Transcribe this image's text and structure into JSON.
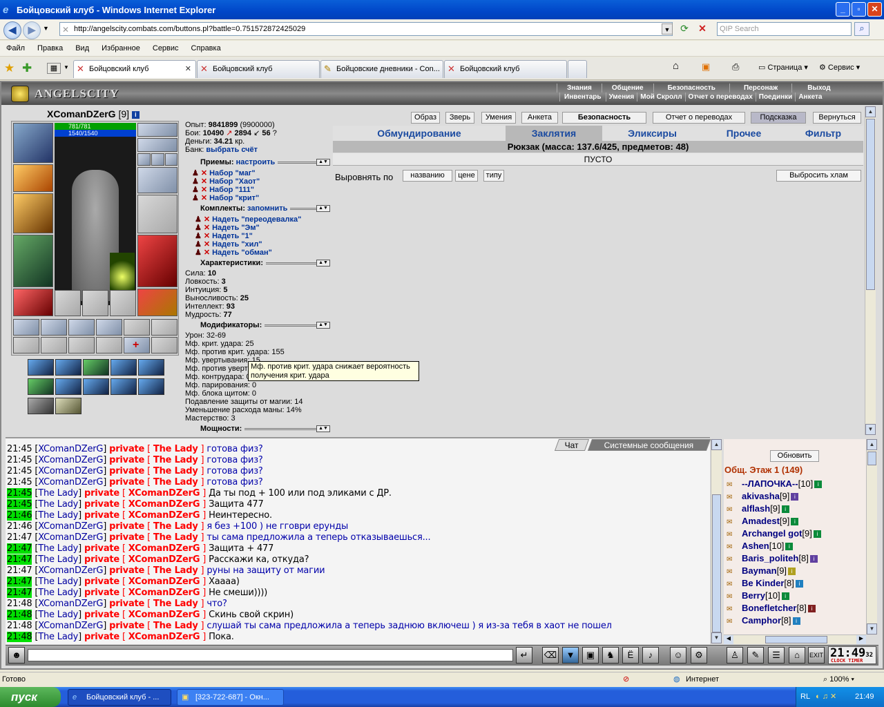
{
  "window": {
    "title": "Бойцовский клуб - Windows Internet Explorer"
  },
  "address": {
    "url": "http://angelscity.combats.com/buttons.pl?battle=0.751572872425029",
    "search_placeholder": "QIP Search"
  },
  "menu": [
    "Файл",
    "Правка",
    "Вид",
    "Избранное",
    "Сервис",
    "Справка"
  ],
  "tabs": [
    {
      "label": "Бойцовский клуб",
      "active": true
    },
    {
      "label": "Бойцовский клуб",
      "active": false
    },
    {
      "label": "Бойцовские дневники - Con...",
      "active": false
    },
    {
      "label": "Бойцовский клуб",
      "active": false
    }
  ],
  "toolbar_right": {
    "page": "Страница",
    "tools": "Сервис"
  },
  "game": {
    "logo": "ANGELSCITY",
    "topnav1": [
      "Знания",
      "Общение",
      "Безопасность",
      "Персонаж",
      "Выход"
    ],
    "topnav2": [
      "Инвентарь",
      "Умения",
      "Мой Скролл",
      "Отчет о переводах",
      "Поединки",
      "Анкета"
    ],
    "char": {
      "name": "XComanDZerG",
      "level": "[9]",
      "hp": "781/781",
      "mana": "1540/1540"
    },
    "exp": {
      "label": "Опыт:",
      "value": "9841899",
      "next": "(9900000)"
    },
    "battles": {
      "label": "Бои:",
      "wins": "10490",
      "losses": "2894",
      "draws": "56"
    },
    "money": {
      "label": "Деньги:",
      "value": "34.21",
      "unit": "кр."
    },
    "bank": {
      "label": "Банк:",
      "link": "выбрать счёт"
    },
    "sections": {
      "tricks": "Приемы:",
      "tricks_link": "настроить",
      "sets": "Комплекты:",
      "sets_link": "запомнить",
      "chars": "Характеристики:",
      "mods": "Модификаторы:",
      "powers": "Мощности:"
    },
    "trick_sets": [
      "Набор \"маг\"",
      "Набор \"Хаот\"",
      "Набор \"111\"",
      "Набор \"крит\""
    ],
    "kits": [
      "Надеть \"переодевалка\"",
      "Надеть \"Эм\"",
      "Надеть \"1\"",
      "Надеть \"хил\"",
      "Надеть \"обман\""
    ],
    "stats": [
      {
        "label": "Сила:",
        "value": "10"
      },
      {
        "label": "Ловкость:",
        "value": "3"
      },
      {
        "label": "Интуиция:",
        "value": "5"
      },
      {
        "label": "Выносливость:",
        "value": "25"
      },
      {
        "label": "Интеллект:",
        "value": "93"
      },
      {
        "label": "Мудрость:",
        "value": "77"
      }
    ],
    "mods": [
      "Урон: 32-69",
      "Мф. крит. удара: 25",
      "Мф. против крит. удара: 155",
      "Мф. увертывания: 15",
      "Мф. против увертывания: 0",
      "Мф. контрудара: 0",
      "Мф. парирования: 0",
      "Мф. блока щитом: 0",
      "Подавление защиты от магии: 14",
      "Уменьшение расхода маны: 14%",
      "Мастерство: 3"
    ],
    "tooltip": "Мф. против крит. удара снижает вероятность получения крит. удара",
    "buttons": [
      "Образ",
      "Зверь",
      "Умения",
      "Анкета",
      "Безопасность",
      "Отчет о переводах",
      "Подсказка",
      "Вернуться"
    ],
    "inv_tabs": [
      "Обмундирование",
      "Заклятия",
      "Эликсиры",
      "Прочее",
      "Фильтр"
    ],
    "backpack": "Рюкзак (масса: 137.6/425, предметов: 48)",
    "empty": "ПУСТО",
    "sort": {
      "label": "Выровнять по",
      "by_name": "названию",
      "by_price": "цене",
      "by_type": "типу",
      "drop": "Выбросить хлам"
    }
  },
  "chat": {
    "tabs": [
      "Чат",
      "Системные сообщения"
    ],
    "lines": [
      {
        "time": "21:45",
        "hl": false,
        "from": "XComanDZerG",
        "to": "The Lady",
        "msg": "готова физ?",
        "own": true
      },
      {
        "time": "21:45",
        "hl": false,
        "from": "XComanDZerG",
        "to": "The Lady",
        "msg": "готова физ?",
        "own": true
      },
      {
        "time": "21:45",
        "hl": false,
        "from": "XComanDZerG",
        "to": "The Lady",
        "msg": "готова физ?",
        "own": true
      },
      {
        "time": "21:45",
        "hl": false,
        "from": "XComanDZerG",
        "to": "The Lady",
        "msg": "готова физ?",
        "own": true
      },
      {
        "time": "21:45",
        "hl": true,
        "from": "The Lady",
        "to": "XComanDZerG",
        "msg": "Да ты под + 100 или под эликами с ДР.",
        "own": false
      },
      {
        "time": "21:45",
        "hl": true,
        "from": "The Lady",
        "to": "XComanDZerG",
        "msg": "Защита 477",
        "own": false
      },
      {
        "time": "21:46",
        "hl": true,
        "from": "The Lady",
        "to": "XComanDZerG",
        "msg": "Неинтересно.",
        "own": false
      },
      {
        "time": "21:46",
        "hl": false,
        "from": "XComanDZerG",
        "to": "The Lady",
        "msg": "я без +100 ) не гговри ерунды",
        "own": true
      },
      {
        "time": "21:47",
        "hl": false,
        "from": "XComanDZerG",
        "to": "The Lady",
        "msg": "ты сама предложила а теперь отказываешься...",
        "own": true
      },
      {
        "time": "21:47",
        "hl": true,
        "from": "The Lady",
        "to": "XComanDZerG",
        "msg": "Защита + 477",
        "own": false
      },
      {
        "time": "21:47",
        "hl": true,
        "from": "The Lady",
        "to": "XComanDZerG",
        "msg": "Расскажи ка, откуда?",
        "own": false
      },
      {
        "time": "21:47",
        "hl": false,
        "from": "XComanDZerG",
        "to": "The Lady",
        "msg": "руны на защиту от магии",
        "own": true
      },
      {
        "time": "21:47",
        "hl": true,
        "from": "The Lady",
        "to": "XComanDZerG",
        "msg": "Хаааа)",
        "own": false
      },
      {
        "time": "21:47",
        "hl": true,
        "from": "The Lady",
        "to": "XComanDZerG",
        "msg": "Не смеши))))",
        "own": false
      },
      {
        "time": "21:48",
        "hl": false,
        "from": "XComanDZerG",
        "to": "The Lady",
        "msg": "что?",
        "own": true
      },
      {
        "time": "21:48",
        "hl": true,
        "from": "The Lady",
        "to": "XComanDZerG",
        "msg": "Скинь свой скрин)",
        "own": false
      },
      {
        "time": "21:48",
        "hl": false,
        "from": "XComanDZerG",
        "to": "The Lady",
        "msg": "слушай ты сама предложила а теперь заднюю включеш ) я из-за тебя в хаот не пошел",
        "own": true
      },
      {
        "time": "21:48",
        "hl": true,
        "from": "The Lady",
        "to": "XComanDZerG",
        "msg": "Пока.",
        "own": false
      }
    ]
  },
  "online": {
    "refresh": "Обновить",
    "floor": "Общ. Этаж 1 (149)",
    "users": [
      {
        "name": "--ЛАПОЧКА--",
        "lvl": "[10]",
        "color": "#0a8a3a"
      },
      {
        "name": "akivasha",
        "lvl": "[9]",
        "color": "#6040a0"
      },
      {
        "name": "alflash",
        "lvl": "[9]",
        "color": "#0a8a3a"
      },
      {
        "name": "Amadest",
        "lvl": "[9]",
        "color": "#0a8a3a"
      },
      {
        "name": "Archangel got",
        "lvl": "[9]",
        "color": "#0a8a3a"
      },
      {
        "name": "Ashen",
        "lvl": "[10]",
        "color": "#0a8a3a"
      },
      {
        "name": "Baris_politeh",
        "lvl": "[8]",
        "color": "#6040a0"
      },
      {
        "name": "Bayman",
        "lvl": "[9]",
        "color": "#b0a020"
      },
      {
        "name": "Be Kinder",
        "lvl": "[8]",
        "color": "#2080c0"
      },
      {
        "name": "Berry",
        "lvl": "[10]",
        "color": "#0a8a3a"
      },
      {
        "name": "Bonefletcher",
        "lvl": "[8]",
        "color": "#802020"
      },
      {
        "name": "Camphor",
        "lvl": "[8]",
        "color": "#2080c0"
      }
    ]
  },
  "clock": {
    "time": "21:49",
    "sec": "32",
    "label": "CLOCK TIMER"
  },
  "status": {
    "left": "Готово",
    "zone": "Интернет",
    "zoom": "100%"
  },
  "taskbar": {
    "start": "пуск",
    "tasks": [
      "Бойцовский клуб - ...",
      "[323-722-687] - Окн..."
    ],
    "lang": "RL",
    "time": "21:49"
  }
}
